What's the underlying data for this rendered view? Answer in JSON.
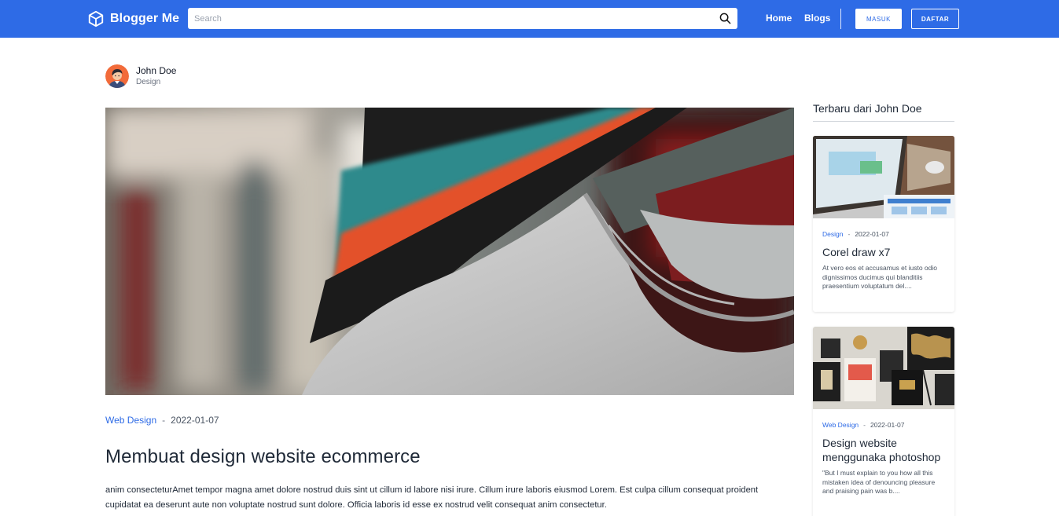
{
  "nav": {
    "brand": "Blogger Me",
    "search_placeholder": "Search",
    "links": [
      "Home",
      "Blogs"
    ],
    "login_label": "MASUK",
    "register_label": "DAFTAR",
    "accent_color": "#2e6be6"
  },
  "author": {
    "name": "John Doe",
    "role": "Design"
  },
  "post": {
    "category": "Web Design",
    "separator": "-",
    "date": "2022-01-07",
    "title": "Membuat design website ecommerce",
    "body": "anim consecteturAmet tempor magna amet dolore nostrud duis sint ut cillum id labore nisi irure. Cillum irure laboris eiusmod Lorem. Est culpa cillum consequat proident cupidatat ea deserunt aute non voluptate nostrud sunt dolore. Officia laboris id esse ex nostrud velit consequat anim consectetur."
  },
  "sidebar": {
    "title": "Terbaru dari John Doe",
    "cards": [
      {
        "category": "Design",
        "date": "2022-01-07",
        "title": "Corel draw x7",
        "excerpt": "At vero eos et accusamus et iusto odio dignissimos ducimus qui blanditiis praesentium voluptatum del....",
        "icon": "laptop-photo"
      },
      {
        "category": "Web Design",
        "date": "2022-01-07",
        "title": "Design website menggunaka photoshop",
        "excerpt": "\"But I must explain to you how all this mistaken idea of denouncing pleasure and praising pain was b....",
        "icon": "stationery-photo"
      }
    ]
  }
}
